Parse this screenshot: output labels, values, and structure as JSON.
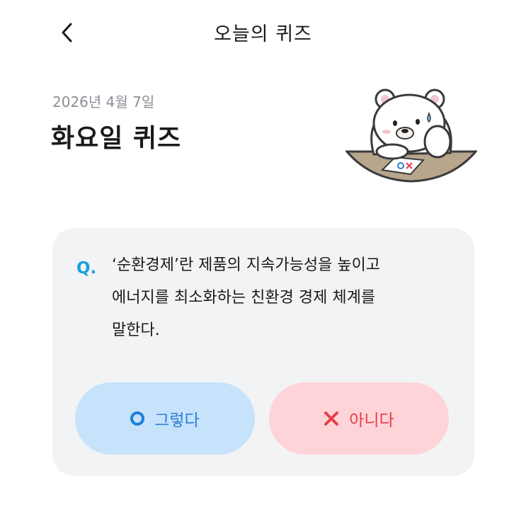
{
  "header": {
    "title": "오늘의 퀴즈",
    "back_icon": "chevron-left-icon"
  },
  "quiz": {
    "date": "2026년 4월 7일",
    "title": "화요일 퀴즈",
    "question_marker": "Q.",
    "question_lines": [
      "‘순환경제’란 제품의 지속가능성을 높이고",
      "에너지를 최소화하는 친환경 경제 체계를",
      "말한다."
    ]
  },
  "answers": {
    "yes_label": "그렇다",
    "no_label": "아니다"
  },
  "illustration": {
    "icon": "bear-illustration",
    "card_text": "OX"
  },
  "colors": {
    "accent_blue": "#1aa0db",
    "yes_bg": "#c7e2fb",
    "no_bg": "#ffd4d9",
    "no_text": "#e53f48"
  }
}
